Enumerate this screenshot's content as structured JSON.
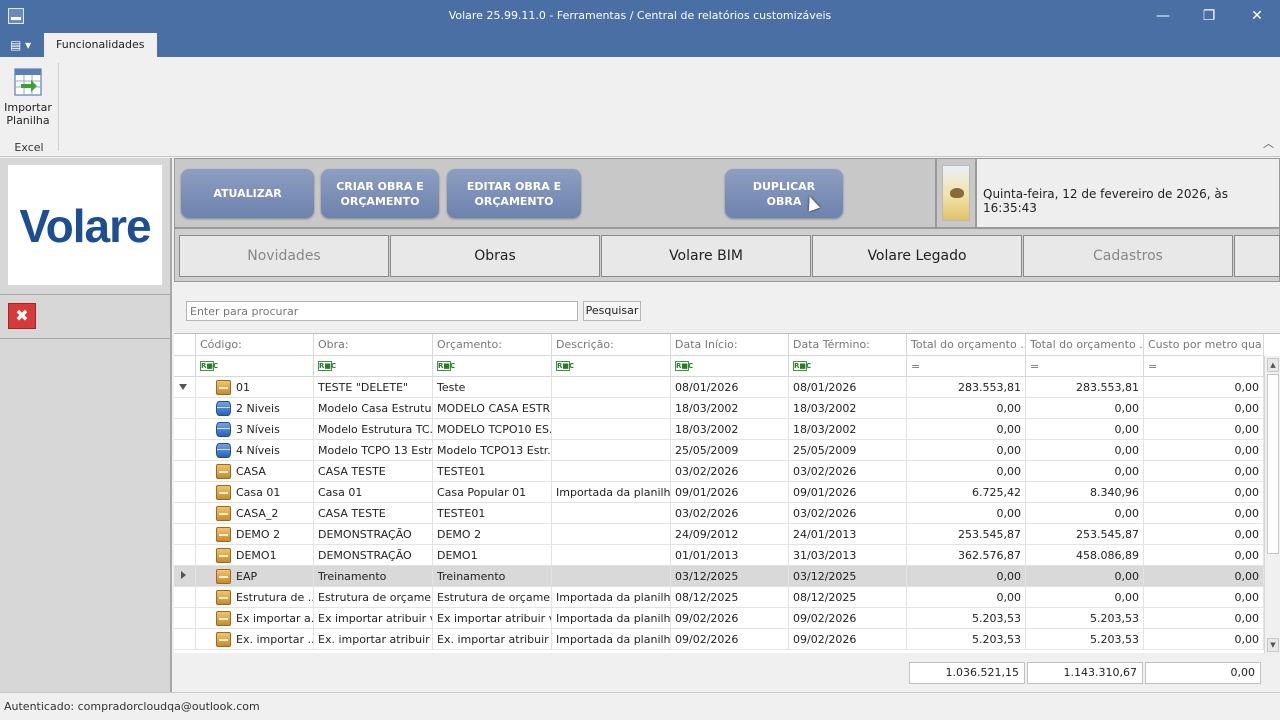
{
  "window": {
    "title": "Volare 25.99.11.0 - Ferramentas / Central de relatórios customizáveis",
    "minimize_glyph": "—",
    "restore_glyph": "❐",
    "close_glyph": "✕"
  },
  "ribbon": {
    "menu_glyph": "▤ ▾",
    "tab_label": "Funcionalidades",
    "import_label_line1": "Importar",
    "import_label_line2": "Planilha",
    "group_label": "Excel",
    "collapse_glyph": "︿"
  },
  "logo": {
    "text": "Volare"
  },
  "left": {
    "close_glyph": "✖"
  },
  "actions": {
    "atualizar": "ATUALIZAR",
    "criar_line1": "CRIAR OBRA E",
    "criar_line2": "ORÇAMENTO",
    "editar_line1": "EDITAR OBRA E",
    "editar_line2": "ORÇAMENTO",
    "duplicar": "DUPLICAR OBRA"
  },
  "datetime": "Quinta-feira, 12 de fevereiro de 2026, às 16:35:43",
  "module_tabs": [
    "Novidades",
    "Obras",
    "Volare BIM",
    "Volare Legado",
    "Cadastros"
  ],
  "search": {
    "placeholder": "Enter para procurar",
    "button_label": "Pesquisar"
  },
  "grid": {
    "columns": [
      "Código:",
      "Obra:",
      "Orçamento:",
      "Descrição:",
      "Data Início:",
      "Data Término:",
      "Total do orçamento ...",
      "Total do orçamento ...",
      "Custo por metro qua..."
    ],
    "filter_text_badge": "R■C",
    "filter_num_badge": "=",
    "rows": [
      {
        "icon": "obra",
        "codigo": "01",
        "obra": "TESTE \"DELETE\"",
        "orcamento": "Teste",
        "descricao": "",
        "inicio": "08/01/2026",
        "termino": "08/01/2026",
        "t1": "283.553,81",
        "t2": "283.553,81",
        "custo": "0,00"
      },
      {
        "icon": "db",
        "codigo": "2 Niveis",
        "obra": "Modelo Casa Estrutura",
        "orcamento": "MODELO CASA ESTR...",
        "descricao": "",
        "inicio": "18/03/2002",
        "termino": "18/03/2002",
        "t1": "0,00",
        "t2": "0,00",
        "custo": "0,00"
      },
      {
        "icon": "db",
        "codigo": "3 Níveis",
        "obra": "Modelo Estrutura TC...",
        "orcamento": "MODELO TCPO10 ES...",
        "descricao": "",
        "inicio": "18/03/2002",
        "termino": "18/03/2002",
        "t1": "0,00",
        "t2": "0,00",
        "custo": "0,00"
      },
      {
        "icon": "db",
        "codigo": "4 Níveis",
        "obra": "Modelo TCPO 13 Estr...",
        "orcamento": "Modelo TCPO13 Estr...",
        "descricao": "",
        "inicio": "25/05/2009",
        "termino": "25/05/2009",
        "t1": "0,00",
        "t2": "0,00",
        "custo": "0,00"
      },
      {
        "icon": "obra",
        "codigo": "CASA",
        "obra": "CASA TESTE",
        "orcamento": "TESTE01",
        "descricao": "",
        "inicio": "03/02/2026",
        "termino": "03/02/2026",
        "t1": "0,00",
        "t2": "0,00",
        "custo": "0,00"
      },
      {
        "icon": "obra",
        "codigo": "Casa 01",
        "obra": "Casa 01",
        "orcamento": "Casa Popular 01",
        "descricao": "Importada da planilh...",
        "inicio": "09/01/2026",
        "termino": "09/01/2026",
        "t1": "6.725,42",
        "t2": "8.340,96",
        "custo": "0,00"
      },
      {
        "icon": "obra",
        "codigo": "CASA_2",
        "obra": "CASA TESTE",
        "orcamento": "TESTE01",
        "descricao": "",
        "inicio": "03/02/2026",
        "termino": "03/02/2026",
        "t1": "0,00",
        "t2": "0,00",
        "custo": "0,00"
      },
      {
        "icon": "obra",
        "codigo": "DEMO 2",
        "obra": "DEMONSTRAÇÃO",
        "orcamento": "DEMO 2",
        "descricao": "",
        "inicio": "24/09/2012",
        "termino": "24/01/2013",
        "t1": "253.545,87",
        "t2": "253.545,87",
        "custo": "0,00"
      },
      {
        "icon": "obra",
        "codigo": "DEMO1",
        "obra": "DEMONSTRAÇÃO",
        "orcamento": "DEMO1",
        "descricao": "",
        "inicio": "01/01/2013",
        "termino": "31/03/2013",
        "t1": "362.576,87",
        "t2": "458.086,89",
        "custo": "0,00"
      },
      {
        "icon": "obra",
        "codigo": "EAP",
        "obra": "Treinamento",
        "orcamento": "Treinamento",
        "descricao": "",
        "inicio": "03/12/2025",
        "termino": "03/12/2025",
        "t1": "0,00",
        "t2": "0,00",
        "custo": "0,00",
        "selected": true
      },
      {
        "icon": "obra",
        "codigo": "Estrutura de ...",
        "obra": "Estrutura de orçame...",
        "orcamento": "Estrutura de orçame...",
        "descricao": "Importada da planilh...",
        "inicio": "08/12/2025",
        "termino": "08/12/2025",
        "t1": "0,00",
        "t2": "0,00",
        "custo": "0,00"
      },
      {
        "icon": "obra",
        "codigo": "Ex importar a...",
        "obra": "Ex importar atribuir v...",
        "orcamento": "Ex importar atribuir v...",
        "descricao": "Importada da planilh...",
        "inicio": "09/02/2026",
        "termino": "09/02/2026",
        "t1": "5.203,53",
        "t2": "5.203,53",
        "custo": "0,00"
      },
      {
        "icon": "obra",
        "codigo": "Ex. importar ...",
        "obra": "Ex. importar atribuir ...",
        "orcamento": "Ex. importar atribuir ...",
        "descricao": "Importada da planilh...",
        "inicio": "09/02/2026",
        "termino": "09/02/2026",
        "t1": "5.203,53",
        "t2": "5.203,53",
        "custo": "0,00"
      }
    ],
    "totals": [
      "1.036.521,15",
      "1.143.310,67",
      "0,00"
    ]
  },
  "status": "Autenticado: compradorcloudqa@outlook.com"
}
